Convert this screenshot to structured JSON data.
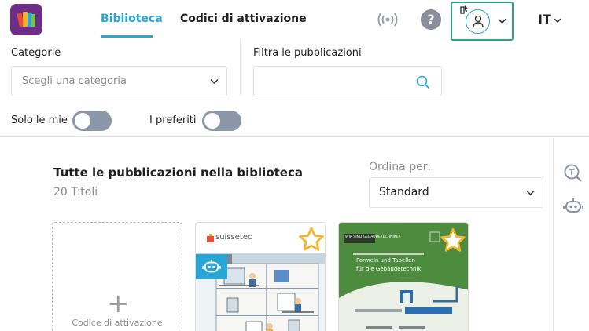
{
  "header": {
    "tabs": [
      {
        "label": "Biblioteca",
        "active": true
      },
      {
        "label": "Codici di attivazione",
        "active": false
      }
    ],
    "help_label": "?",
    "language": "IT",
    "accent_color": "#2aa6d6",
    "highlight_color": "#2aa37f"
  },
  "filters": {
    "category_label": "Categorie",
    "category_placeholder": "Scegli una categoria",
    "filter_label": "Filtra le pubblicazioni",
    "filter_value": "",
    "only_mine_label": "Solo le mie",
    "only_mine_on": false,
    "favorites_label": "I preferiti",
    "favorites_on": false
  },
  "main": {
    "title": "Tutte le pubblicazioni nella biblioteca",
    "count": "20 Titoli",
    "sort_label": "Ordina per:",
    "sort_value": "Standard",
    "add_card_label": "Codice di attivazione",
    "books": [
      {
        "publisher": "suissetec",
        "favorite_icon": "star-icon",
        "badge_icon": "robot-icon"
      },
      {
        "series": "WIR SIND GEBÄUDETECHNIKER",
        "title_line1": "Formeln und Tabellen",
        "title_line2": "für die Gebäudetechnik",
        "favorite_icon": "star-icon"
      }
    ]
  },
  "rail": {
    "icons": [
      "search-text-icon",
      "robot-icon"
    ]
  }
}
